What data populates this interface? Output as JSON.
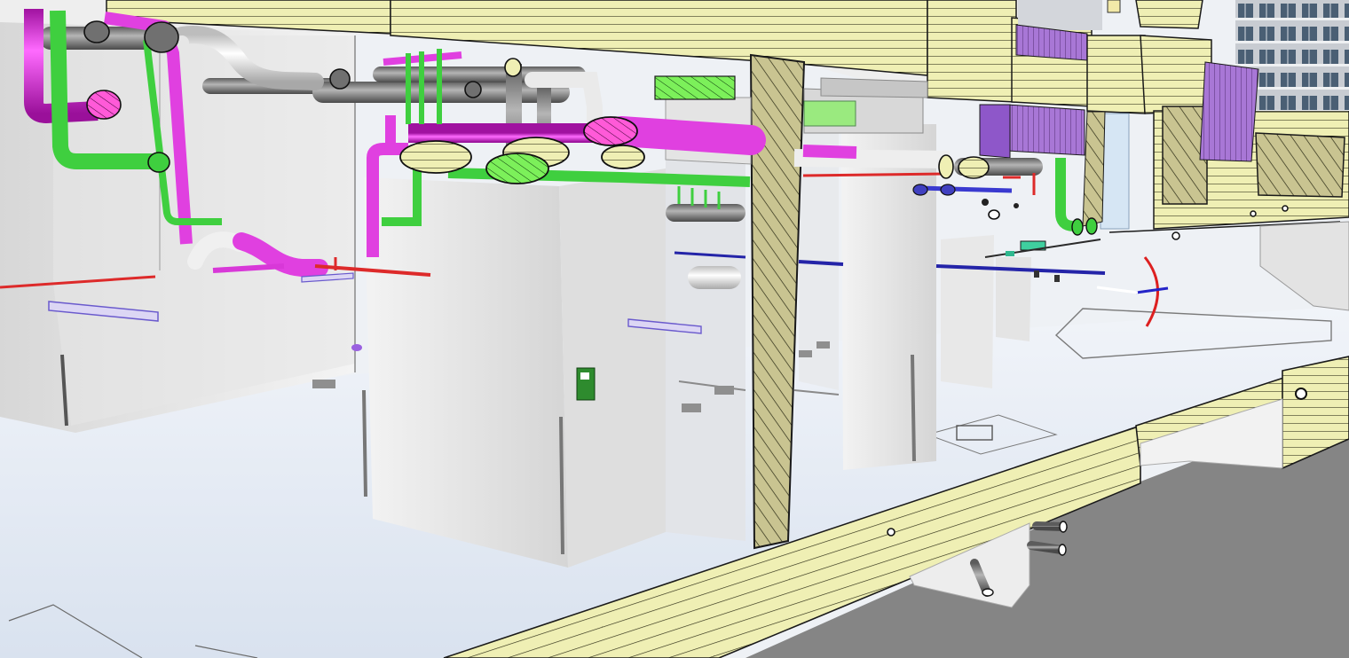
{
  "view": {
    "kind": "3d-bim-section-view",
    "colors": {
      "section_cut": "#efefb4",
      "section_hatch": "#2a2a14",
      "column_cut": "#c9c491",
      "floor": "#e9eef6",
      "wall": "#f2f2f2",
      "ground": "#808080",
      "drain_pipe": "#e040e0",
      "vent_pipe": "#3fcf3f",
      "waste_pipe": "#8c8c8c",
      "white_pipe": "#f4f4f4",
      "fire_pipe": "#dd2a2a",
      "cold_water": "#2424a8",
      "duct_purple": "#a070d0",
      "green_duct": "#90ee70"
    }
  }
}
